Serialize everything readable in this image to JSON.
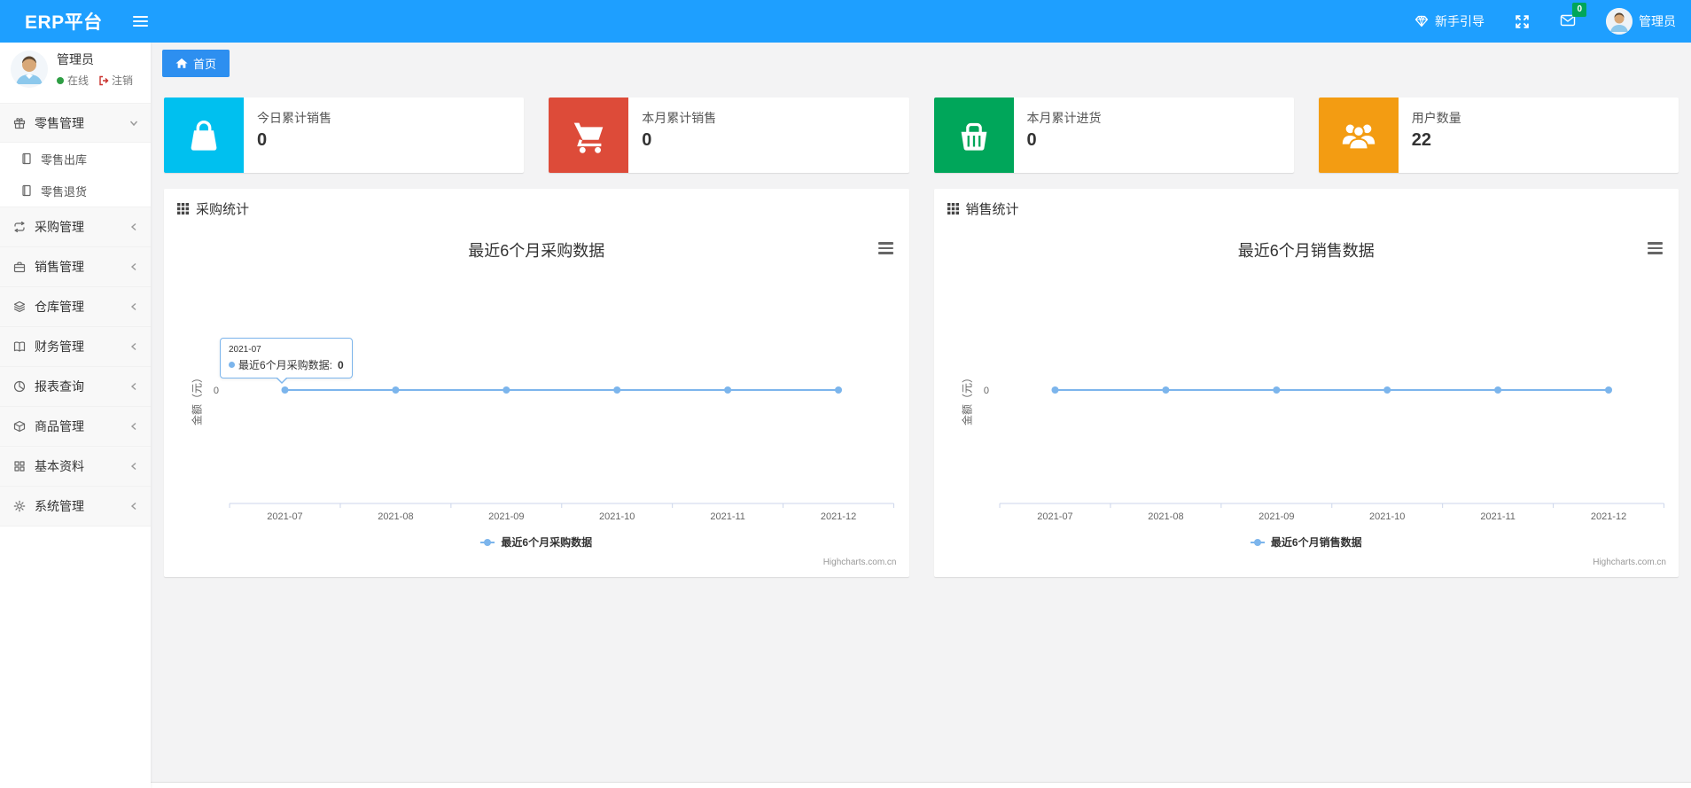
{
  "colors": {
    "navbar_blue": "#1e9fff",
    "tab_blue": "#2d8ff0",
    "card_cyan": "#00c0ef",
    "card_red": "#dd4b39",
    "card_green": "#00a65a",
    "card_orange": "#f39c12",
    "chart_line": "#7cb5ec",
    "mail_badge_green": "#00a65a"
  },
  "navbar": {
    "brand": "ERP平台",
    "guide_label": "新手引导",
    "mail_badge": "0",
    "username": "管理员"
  },
  "sidebar": {
    "user": {
      "name": "管理员",
      "status": "在线",
      "logout_label": "注销"
    },
    "menu": [
      {
        "label": "零售管理",
        "icon": "gift-icon",
        "state": "expanded",
        "children": [
          "零售出库",
          "零售退货"
        ]
      },
      {
        "label": "采购管理",
        "icon": "repeat-icon",
        "state": "collapsed"
      },
      {
        "label": "销售管理",
        "icon": "briefcase-icon",
        "state": "collapsed"
      },
      {
        "label": "仓库管理",
        "icon": "layers-icon",
        "state": "collapsed"
      },
      {
        "label": "财务管理",
        "icon": "book-icon",
        "state": "collapsed"
      },
      {
        "label": "报表查询",
        "icon": "pie-chart-icon",
        "state": "collapsed"
      },
      {
        "label": "商品管理",
        "icon": "package-icon",
        "state": "collapsed"
      },
      {
        "label": "基本资料",
        "icon": "grid-icon",
        "state": "collapsed"
      },
      {
        "label": "系统管理",
        "icon": "gear-icon",
        "state": "collapsed"
      }
    ]
  },
  "breadcrumb": {
    "home": "首页"
  },
  "cards": [
    {
      "title": "今日累计销售",
      "value": "0",
      "icon": "bag-icon",
      "color": "#00c0ef"
    },
    {
      "title": "本月累计销售",
      "value": "0",
      "icon": "cart-icon",
      "color": "#dd4b39"
    },
    {
      "title": "本月累计进货",
      "value": "0",
      "icon": "basket-icon",
      "color": "#00a65a"
    },
    {
      "title": "用户数量",
      "value": "22",
      "icon": "users-icon",
      "color": "#f39c12"
    }
  ],
  "panels": [
    {
      "header": "采购统计"
    },
    {
      "header": "销售统计"
    }
  ],
  "chart_data": [
    {
      "type": "line",
      "title": "最近6个月采购数据",
      "categories": [
        "2021-07",
        "2021-08",
        "2021-09",
        "2021-10",
        "2021-11",
        "2021-12"
      ],
      "series": [
        {
          "name": "最近6个月采购数据",
          "values": [
            0,
            0,
            0,
            0,
            0,
            0
          ]
        }
      ],
      "ylabel": "金额（元）",
      "yticks": [
        0
      ],
      "ylim": [
        -1,
        1
      ],
      "grid": false,
      "legend_position": "bottom",
      "line_color": "#7cb5ec",
      "credits": "Highcharts.com.cn",
      "tooltip": {
        "visible": true,
        "category": "2021-07",
        "series_label": "最近6个月采购数据:",
        "value": "0"
      }
    },
    {
      "type": "line",
      "title": "最近6个月销售数据",
      "categories": [
        "2021-07",
        "2021-08",
        "2021-09",
        "2021-10",
        "2021-11",
        "2021-12"
      ],
      "series": [
        {
          "name": "最近6个月销售数据",
          "values": [
            0,
            0,
            0,
            0,
            0,
            0
          ]
        }
      ],
      "ylabel": "金额（元）",
      "yticks": [
        0
      ],
      "ylim": [
        -1,
        1
      ],
      "grid": false,
      "legend_position": "bottom",
      "line_color": "#7cb5ec",
      "credits": "Highcharts.com.cn",
      "tooltip": {
        "visible": false
      }
    }
  ]
}
